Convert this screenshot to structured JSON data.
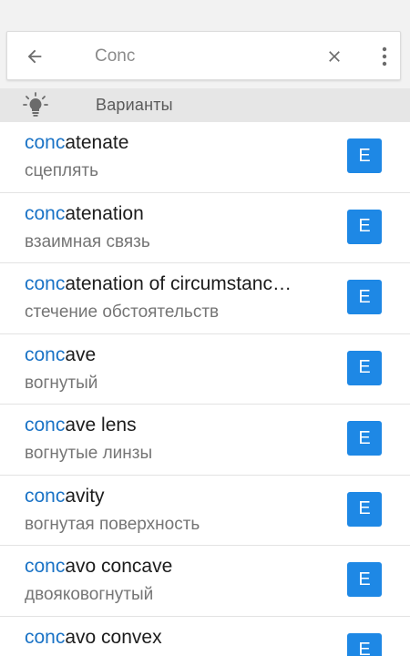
{
  "search": {
    "query": "Conc",
    "back_icon": "arrow-left-icon",
    "clear_icon": "close-icon",
    "more_icon": "more-vertical-icon"
  },
  "suggestions_header": {
    "label": "Варианты",
    "icon": "lightbulb-icon"
  },
  "colors": {
    "highlight": "#1a73c6",
    "badge": "#1e88e5",
    "translation": "#757575"
  },
  "results": [
    {
      "prefix": "conc",
      "rest": "atenate",
      "translation": "сцеплять",
      "badge": "E"
    },
    {
      "prefix": "conc",
      "rest": "atenation",
      "translation": "взаимная связь",
      "badge": "E"
    },
    {
      "prefix": "conc",
      "rest": "atenation of circumstanc…",
      "translation": "стечение обстоятельств",
      "badge": "E"
    },
    {
      "prefix": "conc",
      "rest": "ave",
      "translation": "вогнутый",
      "badge": "E"
    },
    {
      "prefix": "conc",
      "rest": "ave lens",
      "translation": "вогнутые линзы",
      "badge": "E"
    },
    {
      "prefix": "conc",
      "rest": "avity",
      "translation": "вогнутая поверхность",
      "badge": "E"
    },
    {
      "prefix": "conc",
      "rest": "avo concave",
      "translation": "двояковогнутый",
      "badge": "E"
    },
    {
      "prefix": "conc",
      "rest": "avo convex",
      "translation": "",
      "badge": "E"
    }
  ]
}
